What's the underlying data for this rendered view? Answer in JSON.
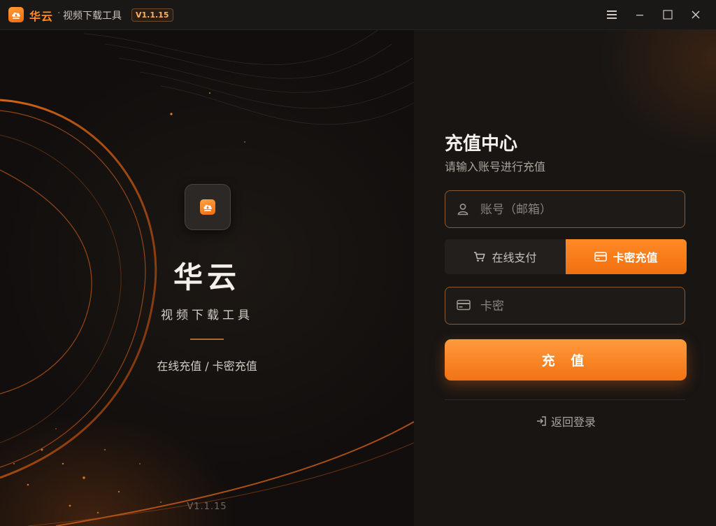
{
  "window": {
    "app_name": "华云",
    "separator": "·",
    "subtitle": "视频下载工具",
    "version_badge": "V1.1.15"
  },
  "hero": {
    "title": "华云",
    "subtitle": "视频下载工具",
    "description": "在线充值 / 卡密充值",
    "version": "V1.1.15"
  },
  "recharge": {
    "title": "充值中心",
    "subtitle": "请输入账号进行充值",
    "account_placeholder": "账号（邮箱）",
    "account_value": "",
    "tabs": [
      {
        "label": "在线支付",
        "active": false,
        "icon": "cart-icon"
      },
      {
        "label": "卡密充值",
        "active": true,
        "icon": "card-icon"
      }
    ],
    "card_placeholder": "卡密",
    "card_value": "",
    "submit_label": "充 值",
    "back_label": "返回登录"
  },
  "colors": {
    "accent": "#ff8a24",
    "background": "#141110",
    "panel": "#181513",
    "field_border": "#8a5a30"
  }
}
